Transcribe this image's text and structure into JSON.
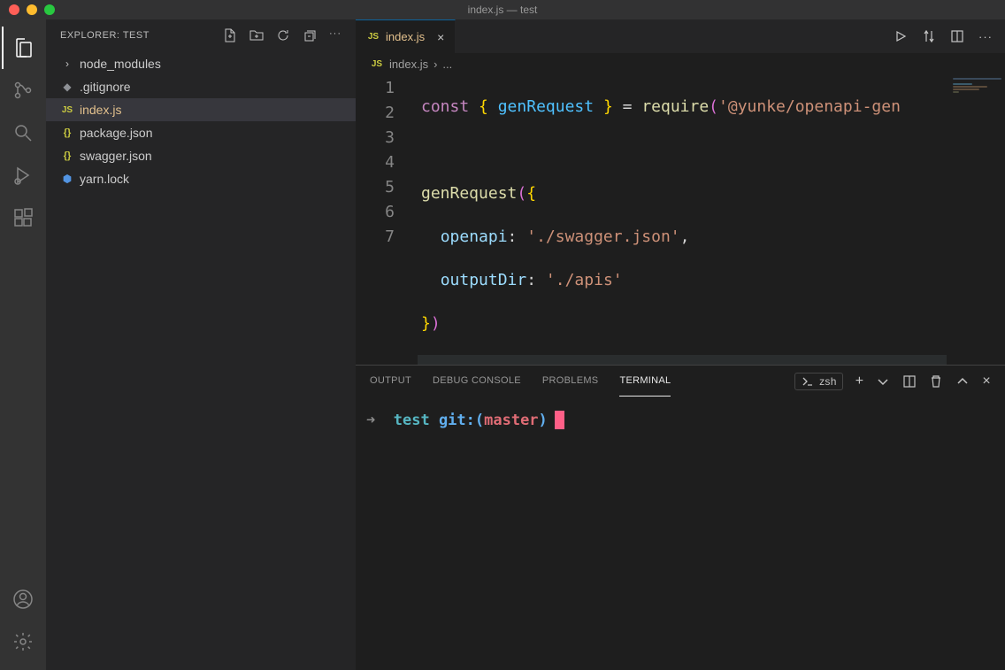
{
  "window": {
    "title": "index.js — test"
  },
  "sidebar": {
    "header": "EXPLORER: TEST",
    "files": [
      {
        "name": "node_modules",
        "icon": "chevron"
      },
      {
        "name": ".gitignore",
        "icon": "git"
      },
      {
        "name": "index.js",
        "icon": "js",
        "active": true,
        "modified": true
      },
      {
        "name": "package.json",
        "icon": "json"
      },
      {
        "name": "swagger.json",
        "icon": "json"
      },
      {
        "name": "yarn.lock",
        "icon": "lock"
      }
    ]
  },
  "tabs": {
    "open": {
      "label": "index.js",
      "modified": true
    }
  },
  "breadcrumb": {
    "file": "index.js",
    "symbol": "..."
  },
  "editor": {
    "lineNumbers": [
      "1",
      "2",
      "3",
      "4",
      "5",
      "6",
      "7"
    ],
    "tokens": {
      "const": "const",
      "genRequest": "genRequest",
      "require": "require",
      "pkg": "'@yunke/openapi-gen",
      "openapi": "openapi",
      "outputDir": "outputDir",
      "swagger": "'./swagger.json'",
      "apis": "'./apis'"
    }
  },
  "panel": {
    "tabs": [
      "OUTPUT",
      "DEBUG CONSOLE",
      "PROBLEMS",
      "TERMINAL"
    ],
    "activeTab": "TERMINAL",
    "shell": "zsh",
    "terminal": {
      "arrow": "➜",
      "dir": "test",
      "git": "git:(",
      "branch": "master",
      "gitClose": ")"
    }
  }
}
